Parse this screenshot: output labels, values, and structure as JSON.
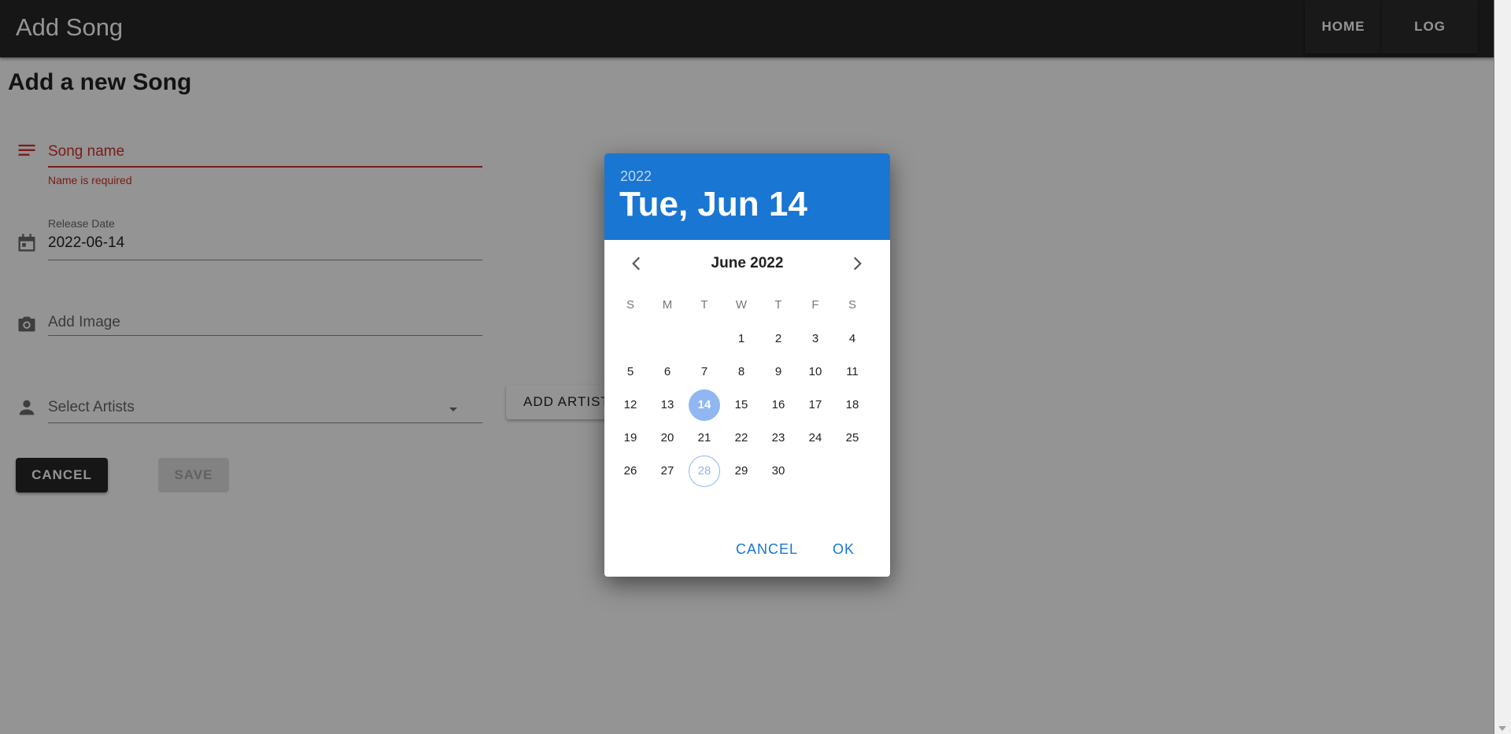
{
  "appbar": {
    "title": "Add Song",
    "nav": [
      {
        "label": "HOME"
      },
      {
        "label": "LOG OUT"
      }
    ]
  },
  "form": {
    "heading": "Add a new Song",
    "song_name": {
      "placeholder": "Song name",
      "error": "Name is required",
      "icon": "subject-icon"
    },
    "release_date": {
      "label": "Release Date",
      "value": "2022-06-14",
      "icon": "calendar-icon"
    },
    "image": {
      "placeholder": "Add Image",
      "icon": "camera-icon"
    },
    "artists": {
      "placeholder": "Select Artists",
      "icon": "person-icon"
    },
    "add_artist_label": "ADD ARTIST",
    "cancel_label": "CANCEL",
    "save_label": "SAVE"
  },
  "datepicker": {
    "year": "2022",
    "selected_label": "Tue, Jun 14",
    "month_label": "June 2022",
    "weekdays": [
      "S",
      "M",
      "T",
      "W",
      "T",
      "F",
      "S"
    ],
    "first_weekday_index": 3,
    "days": [
      "1",
      "2",
      "3",
      "4",
      "5",
      "6",
      "7",
      "8",
      "9",
      "10",
      "11",
      "12",
      "13",
      "14",
      "15",
      "16",
      "17",
      "18",
      "19",
      "20",
      "21",
      "22",
      "23",
      "24",
      "25",
      "26",
      "27",
      "28",
      "29",
      "30"
    ],
    "selected_day": "14",
    "today": "28",
    "cancel_label": "CANCEL",
    "ok_label": "OK"
  },
  "colors": {
    "primary": "#1976d2",
    "selected_day": "#90b7f2",
    "error": "#d32f2f",
    "appbar": "#272727"
  }
}
